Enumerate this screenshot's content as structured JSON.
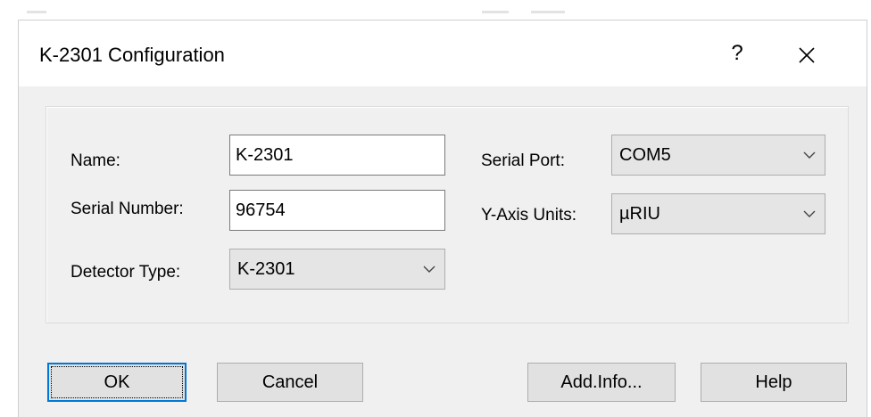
{
  "window": {
    "title": "K-2301 Configuration",
    "help_glyph": "?",
    "close_glyph": "✕"
  },
  "form": {
    "name_label": "Name:",
    "name_value": "K-2301",
    "serial_number_label": "Serial Number:",
    "serial_number_value": "96754",
    "detector_type_label": "Detector Type:",
    "detector_type_value": "K-2301",
    "serial_port_label": "Serial Port:",
    "serial_port_value": "COM5",
    "y_axis_units_label": "Y-Axis Units:",
    "y_axis_units_value": "µRIU"
  },
  "buttons": {
    "ok": "OK",
    "cancel": "Cancel",
    "add_info": "Add.Info...",
    "help": "Help"
  },
  "colors": {
    "dialog_bg": "#f0f0f0",
    "default_button_border": "#0078d7"
  }
}
